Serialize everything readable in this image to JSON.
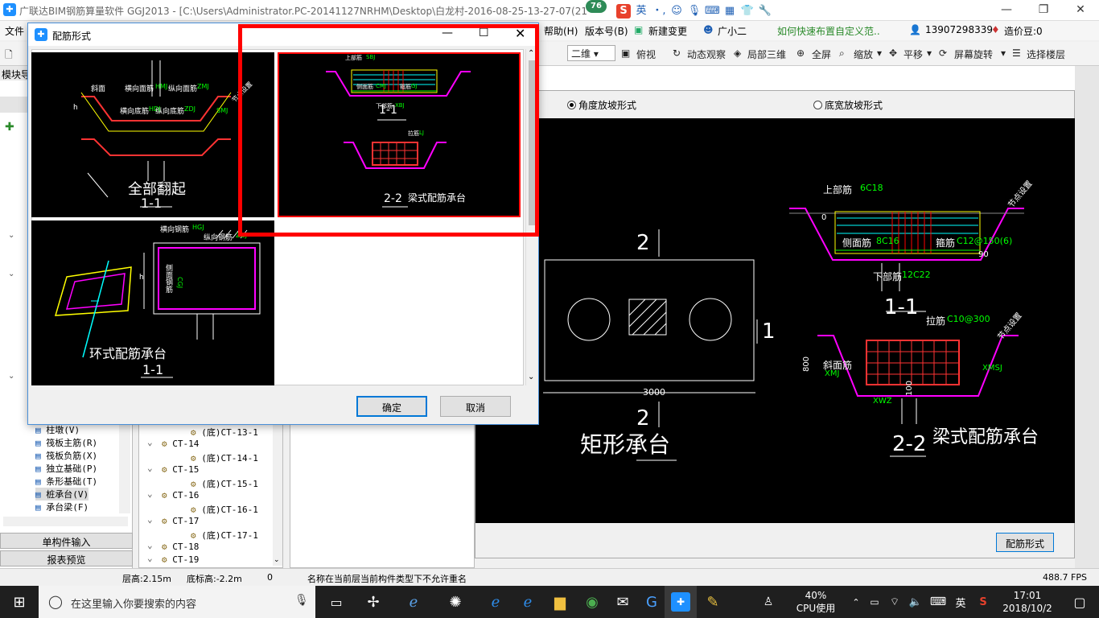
{
  "window": {
    "title": "广联达BIM钢筋算量软件 GGJ2013 - [C:\\Users\\Administrator.PC-20141127NRHM\\Desktop\\白龙村-2016-08-25-13-27-07(21",
    "badge": "76",
    "app_icon": "glodon-logo-icon"
  },
  "ime_bar": {
    "lang": "英",
    "punct": "・,"
  },
  "menu": {
    "file": "文件",
    "help": "帮助(H)",
    "version": "版本号(B)",
    "new_change": "新建变更",
    "assistant": "广小二",
    "tip": "如何快速布置自定义范..",
    "phone": "13907298339",
    "coins": "造价豆:0"
  },
  "toolbar": {
    "view_combo": "二维",
    "view": "俯视",
    "dynamic": "动态观察",
    "local3d": "局部三维",
    "fullscreen": "全屏",
    "zoom": "缩放",
    "pan": "平移",
    "rotate": "屏幕旋转",
    "select_floor": "选择楼层"
  },
  "left_panel": {
    "header": "模块导",
    "items": [
      "柱墩(V)",
      "筏板主筋(R)",
      "筏板负筋(X)",
      "独立基础(P)",
      "条形基础(T)",
      "桩承台(V)",
      "承台梁(F)"
    ],
    "selected": "桩承台(V)",
    "tab_single": "单构件输入",
    "tab_report": "报表预览"
  },
  "tree": {
    "items": [
      "(底)CT-13-1",
      "CT-14",
      "(底)CT-14-1",
      "CT-15",
      "(底)CT-15-1",
      "CT-16",
      "(底)CT-16-1",
      "CT-17",
      "(底)CT-17-1",
      "CT-18",
      "CT-19"
    ]
  },
  "preview": {
    "radio_angle": "角度放坡形式",
    "radio_width": "底宽放坡形式",
    "rebar_button": "配筋形式",
    "drawing": {
      "plan_title": "矩形承台",
      "plan_dim": "3000",
      "sec1_title": "1-1",
      "sec2_title": "2-2",
      "type_title": "梁式配筋承台",
      "top_bar": "上部筋",
      "top_bar_val": "6C18",
      "side_bar": "侧面筋",
      "side_bar_val": "8C16",
      "stirrup": "箍筋",
      "stirrup_val": "C12@150(6)",
      "bottom_bar": "下部筋",
      "bottom_bar_val": "12C22",
      "tie_bar": "拉筋",
      "tie_bar_val": "C10@300",
      "slope_bar": "斜面筋",
      "slope_bar_code": "XMJ",
      "slope_bar_code2": "XMSJ",
      "xwz": "XWZ",
      "dim800": "800",
      "dim100": "100",
      "angle90": "90",
      "zero": "0",
      "section_mark_2": "2",
      "section_mark_1": "1",
      "node": "节点设置"
    }
  },
  "dialog": {
    "title": "配筋形式",
    "icon": "plus-app-icon",
    "options": [
      {
        "caption": "全部翻起",
        "sub": "1-1"
      },
      {
        "caption": "梁式配筋承台",
        "sub": "2-2"
      },
      {
        "caption": "环式配筋承台",
        "sub": "1-1"
      }
    ],
    "labels": {
      "lateral_top": "横向面筋",
      "lateral_top_code": "HMJ",
      "long_top": "纵向面筋",
      "long_top_code": "ZMJ",
      "lateral_bot": "横向底筋",
      "lateral_bot_code": "HDJ",
      "long_bot": "纵向底筋",
      "long_bot_code": "ZDJ",
      "slope": "斜面",
      "slope_code": "SMJ",
      "node_set": "节点设置",
      "h": "h",
      "lateral_steel": "横向钢筋",
      "lateral_steel_code": "HGJ",
      "long_steel": "纵向钢筋",
      "long_steel_code": "ZGJ",
      "side_steel": "侧面钢筋",
      "side_steel_code": "CGJ",
      "top_label": "上部筋",
      "top_code": "SBJ",
      "side_label": "侧面筋",
      "side_code": "CMJ",
      "stir_label": "箍筋",
      "stir_code": "GJ",
      "bot_label": "下部筋",
      "bot_code": "XBJ",
      "tie_label": "拉筋",
      "tie_code": "LJ"
    },
    "ok": "确定",
    "cancel": "取消"
  },
  "status": {
    "floor_h": "层高:2.15m",
    "base_h": "底标高:-2.2m",
    "zero": "0",
    "msg": "名称在当前层当前构件类型下不允许重名",
    "fps": "488.7 FPS"
  },
  "taskbar": {
    "search": "在这里输入你要搜索的内容",
    "cpu_pct": "40%",
    "cpu_label": "CPU使用",
    "lang": "英",
    "time": "17:01",
    "date": "2018/10/2"
  },
  "colors": {
    "highlight": "#ff0000",
    "magenta": "#ff00ff",
    "cyan": "#00ffff",
    "yellow": "#ffff00",
    "green": "#00ff00"
  }
}
